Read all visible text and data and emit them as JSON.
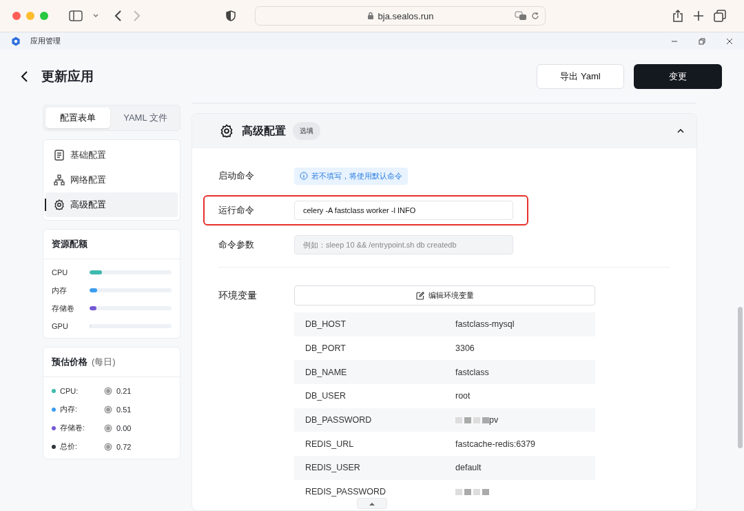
{
  "browser": {
    "url": "bja.sealos.run"
  },
  "app_bar": {
    "title": "应用管理"
  },
  "header": {
    "title": "更新应用",
    "buttons": [
      {
        "label": "导出 Yaml",
        "kind": "secondary"
      },
      {
        "label": "变更",
        "kind": "primary"
      }
    ]
  },
  "mode_tabs": [
    {
      "label": "配置表单",
      "selected": true
    },
    {
      "label": "YAML 文件",
      "selected": false
    }
  ],
  "nav": [
    {
      "label": "基础配置",
      "selected": false
    },
    {
      "label": "网络配置",
      "selected": false
    },
    {
      "label": "高级配置",
      "selected": true
    }
  ],
  "resources": {
    "title": "资源配额",
    "items": [
      {
        "name": "CPU",
        "level": 0.15,
        "color": "#3fb9ad"
      },
      {
        "name": "内存",
        "level": 0.09,
        "color": "#3b9cf0"
      },
      {
        "name": "存储卷",
        "level": 0.08,
        "color": "#7358d6"
      },
      {
        "name": "GPU",
        "level": 0
      }
    ]
  },
  "price": {
    "title": "预估价格",
    "period": "(每日)",
    "items": [
      {
        "name": "CPU:",
        "value": "0.21",
        "color": "#3fb9ad"
      },
      {
        "name": "内存:",
        "value": "0.51",
        "color": "#3b9cf0"
      },
      {
        "name": "存储卷:",
        "value": "0.00",
        "color": "#7358d6"
      },
      {
        "name": "总价:",
        "value": "0.72",
        "color": "#30353d"
      }
    ]
  },
  "section": {
    "title": "高级配置",
    "badge": "选填",
    "expanded": true,
    "startup": {
      "label": "启动命令",
      "hint": "若不填写，将使用默认命令"
    },
    "run_command": {
      "label": "运行命令",
      "value": "celery -A fastclass worker -l INFO",
      "highlighted": true
    },
    "args": {
      "label": "命令参数",
      "placeholder": "例如：sleep 10 && /entrypoint.sh db createdb"
    },
    "env": {
      "label": "环境变量",
      "edit_button": "编辑环境变量",
      "rows": [
        {
          "key": "DB_HOST",
          "value": "fastclass-mysql",
          "redacted": false
        },
        {
          "key": "DB_PORT",
          "value": "3306",
          "redacted": false
        },
        {
          "key": "DB_NAME",
          "value": "fastclass",
          "redacted": false
        },
        {
          "key": "DB_USER",
          "value": "root",
          "redacted": false
        },
        {
          "key": "DB_PASSWORD",
          "value": "pv",
          "redacted": true
        },
        {
          "key": "REDIS_URL",
          "value": "fastcache-redis:6379",
          "redacted": false
        },
        {
          "key": "REDIS_USER",
          "value": "default",
          "redacted": false
        },
        {
          "key": "REDIS_PASSWORD",
          "redacted": true
        }
      ]
    }
  }
}
